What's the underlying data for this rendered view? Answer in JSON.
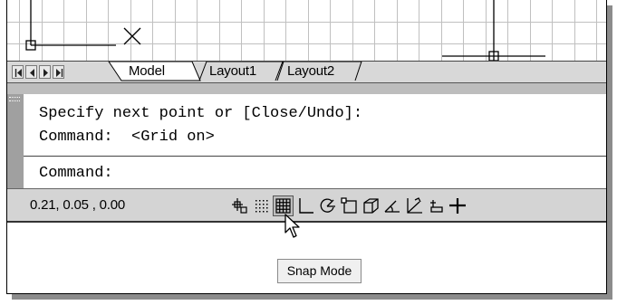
{
  "tabs": {
    "model": "Model",
    "layout1": "Layout1",
    "layout2": "Layout2"
  },
  "command": {
    "line1": "Specify next point or [Close/Undo]:",
    "line2": "Command:  <Grid on>",
    "prompt": "Command:"
  },
  "status": {
    "coordinates": "0.21, 0.05 , 0.00",
    "buttons": [
      {
        "name": "infer-constraints",
        "state": "off"
      },
      {
        "name": "snap-mode",
        "state": "off"
      },
      {
        "name": "grid-display",
        "state": "on"
      },
      {
        "name": "ortho-mode",
        "state": "off"
      },
      {
        "name": "polar-tracking",
        "state": "off"
      },
      {
        "name": "object-snap",
        "state": "off"
      },
      {
        "name": "3d-object-snap",
        "state": "off"
      },
      {
        "name": "object-snap-tracking",
        "state": "off"
      },
      {
        "name": "dynamic-ucs",
        "state": "off"
      },
      {
        "name": "dynamic-input",
        "state": "off"
      },
      {
        "name": "lineweight",
        "state": "off"
      }
    ]
  },
  "tooltip": "Snap Mode",
  "colors": {
    "grid": "#c0c0c0",
    "statusbar": "#d4d4d4",
    "grip": "#a0a0a0"
  }
}
